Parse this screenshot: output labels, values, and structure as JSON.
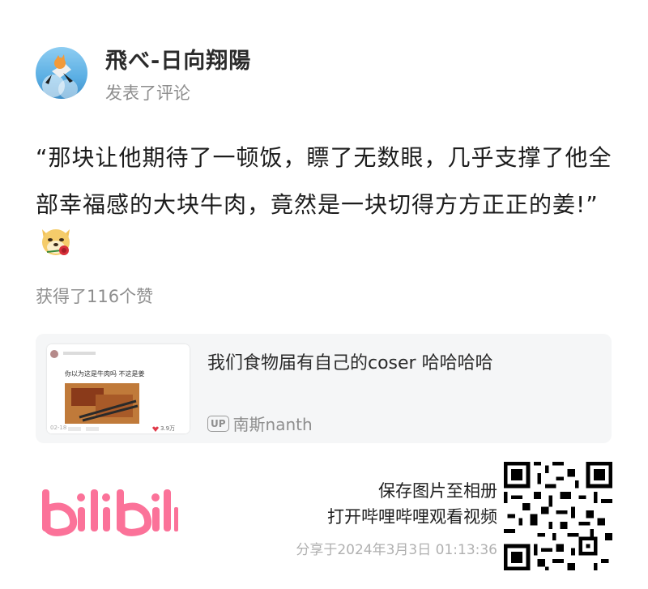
{
  "user": {
    "name": "飛べ-日向翔陽",
    "action": "发表了评论"
  },
  "comment": {
    "text": "“那块让他期待了一顿饭，瞟了无数眼，几乎支撑了他全部幸福感的大块牛肉，竟然是一块切得方方正正的姜!”",
    "emoji": "doge-rose-emoji"
  },
  "likes": "获得了116个赞",
  "video": {
    "title": "我们食物届有自己的coser 哈哈哈哈",
    "uploader_badge": "UP",
    "uploader": "南斯nanth",
    "thumbnail": {
      "caption": "你以为这是牛肉吗 不这是姜",
      "meta_left": "02-18",
      "likes": "3.9万"
    }
  },
  "footer": {
    "logo": "bilibili",
    "save": "保存图片至相册",
    "open": "打开哔哩哔哩观看视频",
    "share_time": "分享于2024年3月3日 01:13:36"
  },
  "colors": {
    "brand_pink": "#fb7299",
    "muted": "#8e8e8e",
    "card_bg": "#f5f6f7"
  }
}
